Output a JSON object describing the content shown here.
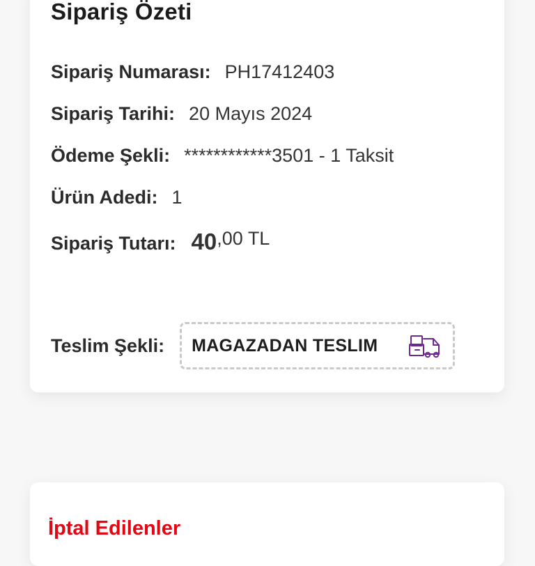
{
  "summary": {
    "title": "Sipariş Özeti",
    "order_number": {
      "label": "Sipariş Numarası:",
      "value": "PH17412403"
    },
    "order_date": {
      "label": "Sipariş Tarihi:",
      "value": "20 Mayıs 2024"
    },
    "payment": {
      "label": "Ödeme Şekli:",
      "value": "************3501 - 1 Taksit"
    },
    "item_count": {
      "label": "Ürün Adedi:",
      "value": "1"
    },
    "total": {
      "label": "Sipariş Tutarı:",
      "amount_int": "40",
      "amount_rest": ",00 TL"
    },
    "delivery": {
      "label": "Teslim Şekli:",
      "value": "MAGAZADAN TESLIM",
      "icon": "delivery-truck-icon"
    }
  },
  "cancelled": {
    "title": "İptal Edilenler"
  },
  "colors": {
    "accent_red": "#e30613",
    "icon_purple": "#6b2a8e",
    "card_bg": "#ffffff",
    "page_bg": "#f7f7f7"
  }
}
